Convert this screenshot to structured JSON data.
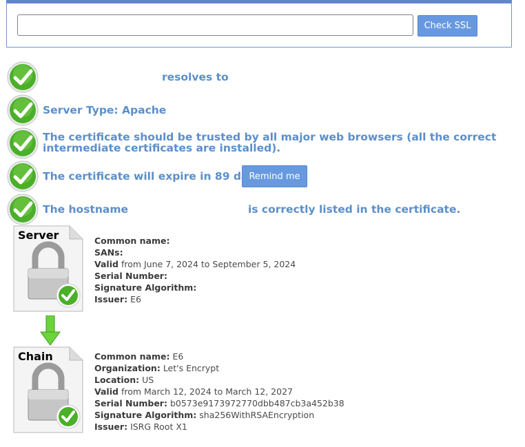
{
  "search": {
    "placeholder": "",
    "value": "",
    "button": "Check SSL"
  },
  "results": [
    {
      "text": "resolves to"
    },
    {
      "text": "Server Type: Apache"
    },
    {
      "text": "The certificate should be trusted by all major web browsers (all the correct intermediate certificates are installed)."
    },
    {
      "text": "The certificate will expire in 89 days.",
      "action": "Remind me"
    },
    {
      "text_before": "The hostname",
      "text_after": "is correctly listed in the certificate."
    }
  ],
  "certificates": [
    {
      "badge": "Server",
      "fields": [
        {
          "label": "Common name:",
          "value": ""
        },
        {
          "label": "SANs:",
          "value": ""
        },
        {
          "label": "Valid",
          "value": "from June 7, 2024 to September 5, 2024"
        },
        {
          "label": "Serial Number:",
          "value": ""
        },
        {
          "label": "Signature Algorithm:",
          "value": ""
        },
        {
          "label": "Issuer:",
          "value": "E6"
        }
      ]
    },
    {
      "badge": "Chain",
      "fields": [
        {
          "label": "Common name:",
          "value": "E6"
        },
        {
          "label": "Organization:",
          "value": "Let's Encrypt"
        },
        {
          "label": "Location:",
          "value": "US"
        },
        {
          "label": "Valid",
          "value": "from March 12, 2024 to March 12, 2027"
        },
        {
          "label": "Serial Number:",
          "value": "b0573e9173972770dbb487cb3a452b38"
        },
        {
          "label": "Signature Algorithm:",
          "value": "sha256WithRSAEncryption"
        },
        {
          "label": "Issuer:",
          "value": "ISRG Root X1"
        }
      ]
    }
  ],
  "colors": {
    "accent": "#5b8fc9",
    "button": "#6799e1",
    "check": "#4caf2a"
  }
}
